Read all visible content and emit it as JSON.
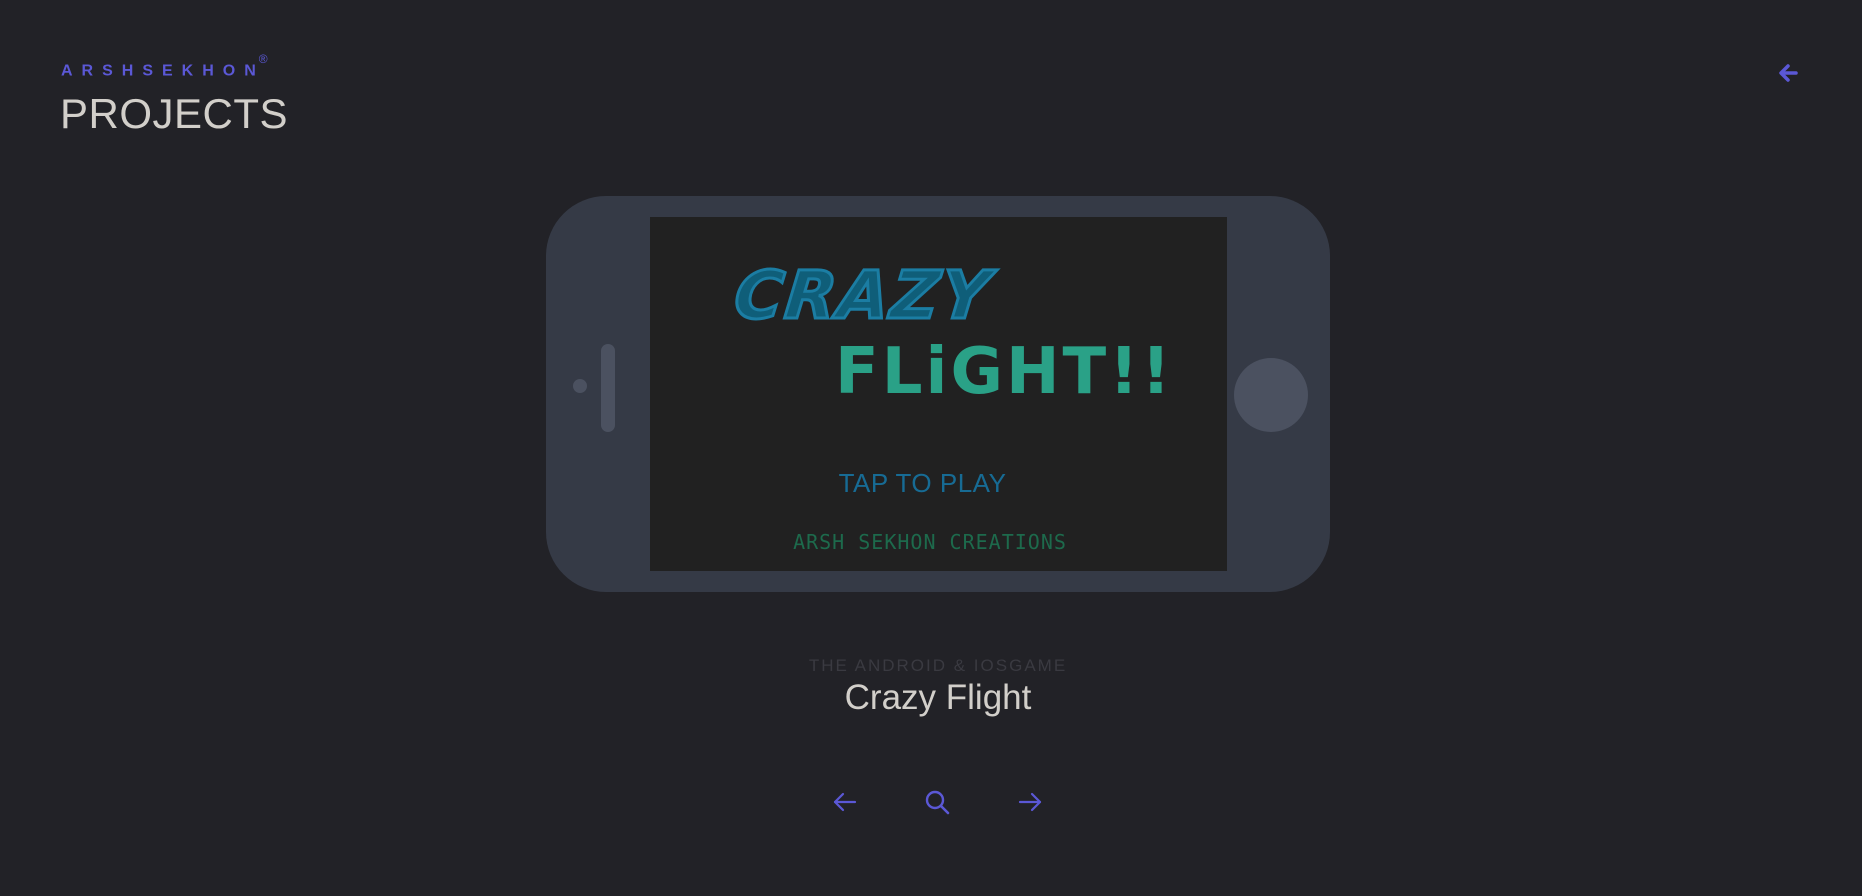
{
  "header": {
    "brand": "ARSHSEKHON",
    "brand_mark": "®",
    "title": "PROJECTS",
    "back_icon": "arrow-left-icon"
  },
  "project": {
    "screen": {
      "title_line_1": "CRAZY",
      "title_line_2": "FLiGHT!!",
      "tap_label": "TAP TO PLAY",
      "studio": "ARSH SEKHON CREATIONS"
    },
    "subtitle": "THE ANDROID & IOSGAME",
    "name": "Crazy Flight"
  },
  "navigation": {
    "prev_icon": "arrow-left-icon",
    "search_icon": "search-icon",
    "next_icon": "arrow-right-icon"
  },
  "colors": {
    "background": "#222227",
    "accent": "#5b58d6",
    "heading": "#d2cfca",
    "phone_body": "#353a46"
  }
}
